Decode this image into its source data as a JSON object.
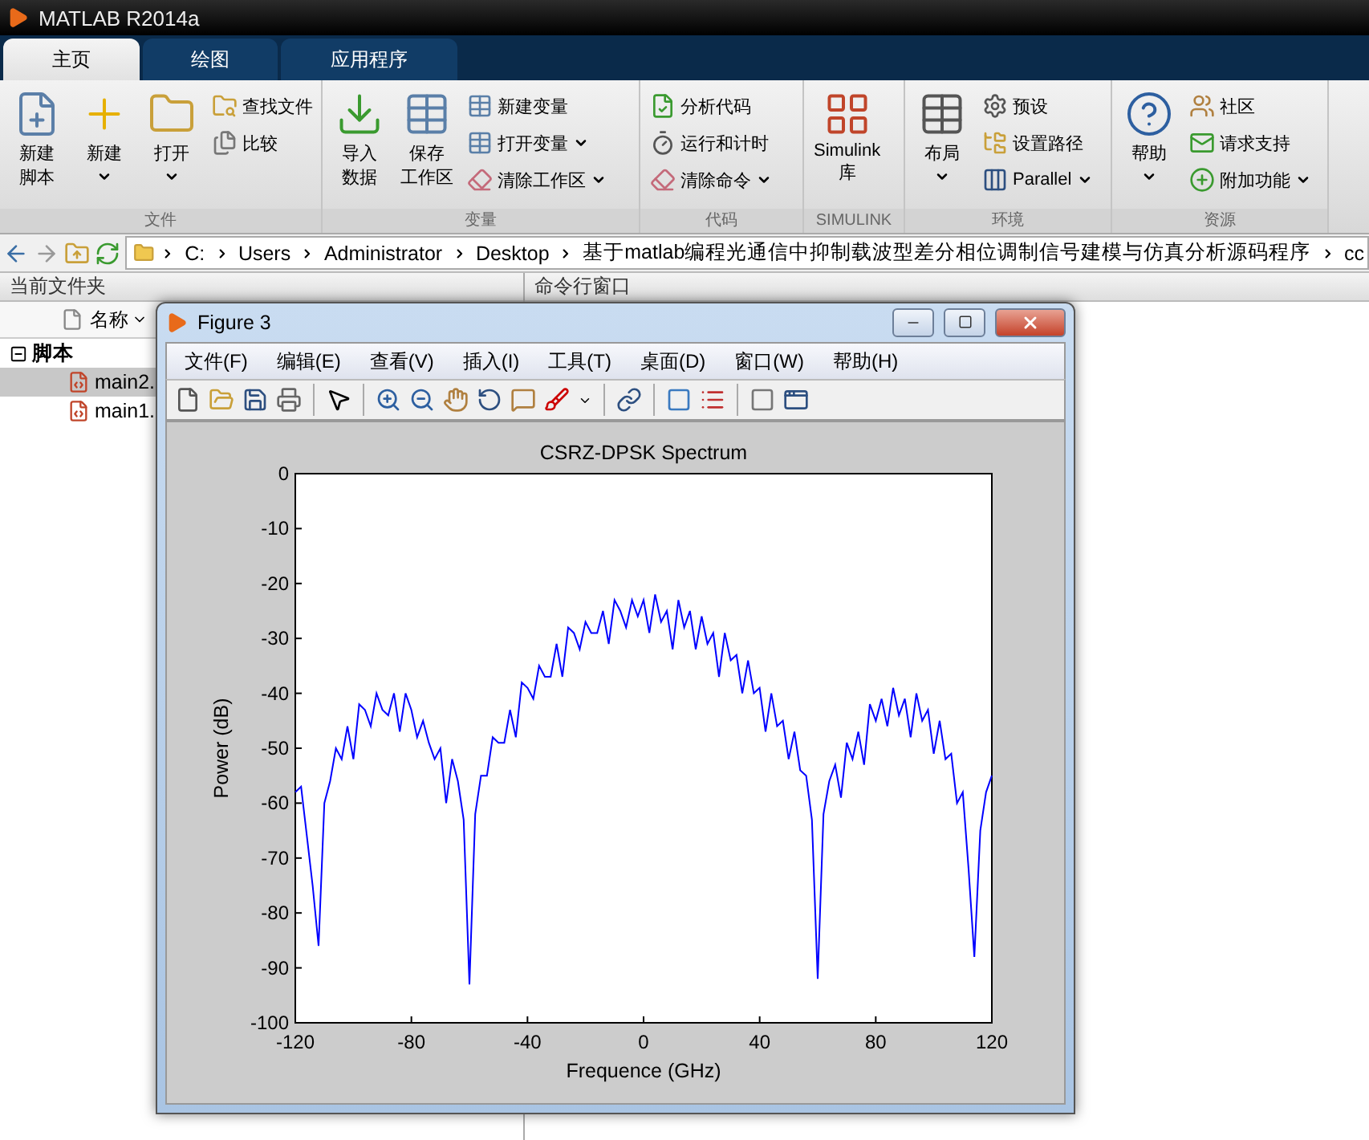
{
  "window": {
    "title": "MATLAB R2014a"
  },
  "tabs": [
    {
      "label": "主页",
      "selected": true
    },
    {
      "label": "绘图",
      "selected": false
    },
    {
      "label": "应用程序",
      "selected": false
    }
  ],
  "ribbon": {
    "groups": [
      {
        "label": "文件",
        "items": [
          {
            "kind": "large",
            "lines": [
              "新建",
              "脚本"
            ],
            "dropdown": false
          },
          {
            "kind": "large",
            "lines": [
              "新建"
            ],
            "dropdown": true
          },
          {
            "kind": "large",
            "lines": [
              "打开"
            ],
            "dropdown": true
          },
          {
            "kind": "small",
            "label": "查找文件",
            "dropdown": false
          },
          {
            "kind": "small",
            "label": "比较",
            "dropdown": false
          }
        ]
      },
      {
        "label": "变量",
        "items": [
          {
            "kind": "large",
            "lines": [
              "导入",
              "数据"
            ],
            "dropdown": false
          },
          {
            "kind": "large",
            "lines": [
              "保存",
              "工作区"
            ],
            "dropdown": false
          },
          {
            "kind": "small",
            "label": "新建变量",
            "dropdown": false
          },
          {
            "kind": "small",
            "label": "打开变量",
            "dropdown": true
          },
          {
            "kind": "small",
            "label": "清除工作区",
            "dropdown": true
          }
        ]
      },
      {
        "label": "代码",
        "items": [
          {
            "kind": "small",
            "label": "分析代码",
            "dropdown": false
          },
          {
            "kind": "small",
            "label": "运行和计时",
            "dropdown": false
          },
          {
            "kind": "small",
            "label": "清除命令",
            "dropdown": true
          }
        ]
      },
      {
        "label": "SIMULINK",
        "items": [
          {
            "kind": "large",
            "lines": [
              "Simulink",
              "库"
            ],
            "dropdown": false
          }
        ]
      },
      {
        "label": "环境",
        "items": [
          {
            "kind": "large",
            "lines": [
              "布局"
            ],
            "dropdown": true
          },
          {
            "kind": "small",
            "label": "预设",
            "dropdown": false
          },
          {
            "kind": "small",
            "label": "设置路径",
            "dropdown": false
          },
          {
            "kind": "small",
            "label": "Parallel",
            "dropdown": true
          }
        ]
      },
      {
        "label": "资源",
        "items": [
          {
            "kind": "large",
            "lines": [
              "帮助"
            ],
            "dropdown": true
          },
          {
            "kind": "small",
            "label": "社区",
            "dropdown": false
          },
          {
            "kind": "small",
            "label": "请求支持",
            "dropdown": false
          },
          {
            "kind": "small",
            "label": "附加功能",
            "dropdown": true
          }
        ]
      }
    ]
  },
  "address_bar": {
    "path": [
      "C:",
      "Users",
      "Administrator",
      "Desktop",
      "基于matlab编程光通信中抑制载波型差分相位调制信号建模与仿真分析源码程序",
      "cc"
    ]
  },
  "current_folder": {
    "title": "当前文件夹",
    "column": "名称",
    "tree": [
      {
        "label": "脚本",
        "expanded": true,
        "children": [
          {
            "label": "main2.",
            "selected": true
          },
          {
            "label": "main1.",
            "selected": false
          }
        ]
      }
    ]
  },
  "command_window": {
    "title": "命令行窗口"
  },
  "figure": {
    "title": "Figure 3",
    "menu": [
      "文件(F)",
      "编辑(E)",
      "查看(V)",
      "插入(I)",
      "工具(T)",
      "桌面(D)",
      "窗口(W)",
      "帮助(H)"
    ],
    "chart_data": {
      "type": "line",
      "title": "CSRZ-DPSK Spectrum",
      "xlabel": "Frequence (GHz)",
      "ylabel": "Power (dB)",
      "xlim": [
        -120,
        120
      ],
      "ylim": [
        -100,
        0
      ],
      "xticks": [
        -120,
        -80,
        -40,
        0,
        40,
        80,
        120
      ],
      "yticks": [
        -100,
        -90,
        -80,
        -70,
        -60,
        -50,
        -40,
        -30,
        -20,
        -10,
        0
      ],
      "x": [
        -120,
        -118,
        -116,
        -114,
        -112,
        -110,
        -108,
        -106,
        -104,
        -102,
        -100,
        -98,
        -96,
        -94,
        -92,
        -90,
        -88,
        -86,
        -84,
        -82,
        -80,
        -78,
        -76,
        -74,
        -72,
        -70,
        -68,
        -66,
        -64,
        -62,
        -60,
        -58,
        -56,
        -54,
        -52,
        -50,
        -48,
        -46,
        -44,
        -42,
        -40,
        -38,
        -36,
        -34,
        -32,
        -30,
        -28,
        -26,
        -24,
        -22,
        -20,
        -18,
        -16,
        -14,
        -12,
        -10,
        -8,
        -6,
        -4,
        -2,
        0,
        2,
        4,
        6,
        8,
        10,
        12,
        14,
        16,
        18,
        20,
        22,
        24,
        26,
        28,
        30,
        32,
        34,
        36,
        38,
        40,
        42,
        44,
        46,
        48,
        50,
        52,
        54,
        56,
        58,
        60,
        62,
        64,
        66,
        68,
        70,
        72,
        74,
        76,
        78,
        80,
        82,
        84,
        86,
        88,
        90,
        92,
        94,
        96,
        98,
        100,
        102,
        104,
        106,
        108,
        110,
        112,
        114,
        116,
        118,
        120
      ],
      "series": [
        {
          "color": "#0000ff",
          "values": [
            -58,
            -57,
            -66,
            -75,
            -86,
            -60,
            -56,
            -50,
            -52,
            -46,
            -52,
            -42,
            -43,
            -46,
            -40,
            -43,
            -44,
            -40,
            -47,
            -40,
            -43,
            -48,
            -45,
            -49,
            -52,
            -50,
            -60,
            -52,
            -56,
            -63,
            -93,
            -62,
            -55,
            -55,
            -48,
            -49,
            -49,
            -43,
            -48,
            -38,
            -39,
            -41,
            -35,
            -37,
            -37,
            -31,
            -37,
            -28,
            -29,
            -32,
            -27,
            -29,
            -29,
            -25,
            -31,
            -23,
            -25,
            -28,
            -23,
            -26,
            -23,
            -29,
            -22,
            -27,
            -25,
            -32,
            -23,
            -28,
            -25,
            -32,
            -26,
            -31,
            -29,
            -37,
            -29,
            -34,
            -33,
            -40,
            -34,
            -40,
            -39,
            -47,
            -40,
            -46,
            -45,
            -52,
            -47,
            -54,
            -55,
            -63,
            -92,
            -62,
            -56,
            -53,
            -59,
            -49,
            -52,
            -47,
            -53,
            -42,
            -45,
            -41,
            -46,
            -39,
            -44,
            -41,
            -48,
            -40,
            -45,
            -43,
            -51,
            -45,
            -52,
            -51,
            -60,
            -58,
            -72,
            -88,
            -65,
            -58,
            -55
          ]
        }
      ]
    }
  }
}
